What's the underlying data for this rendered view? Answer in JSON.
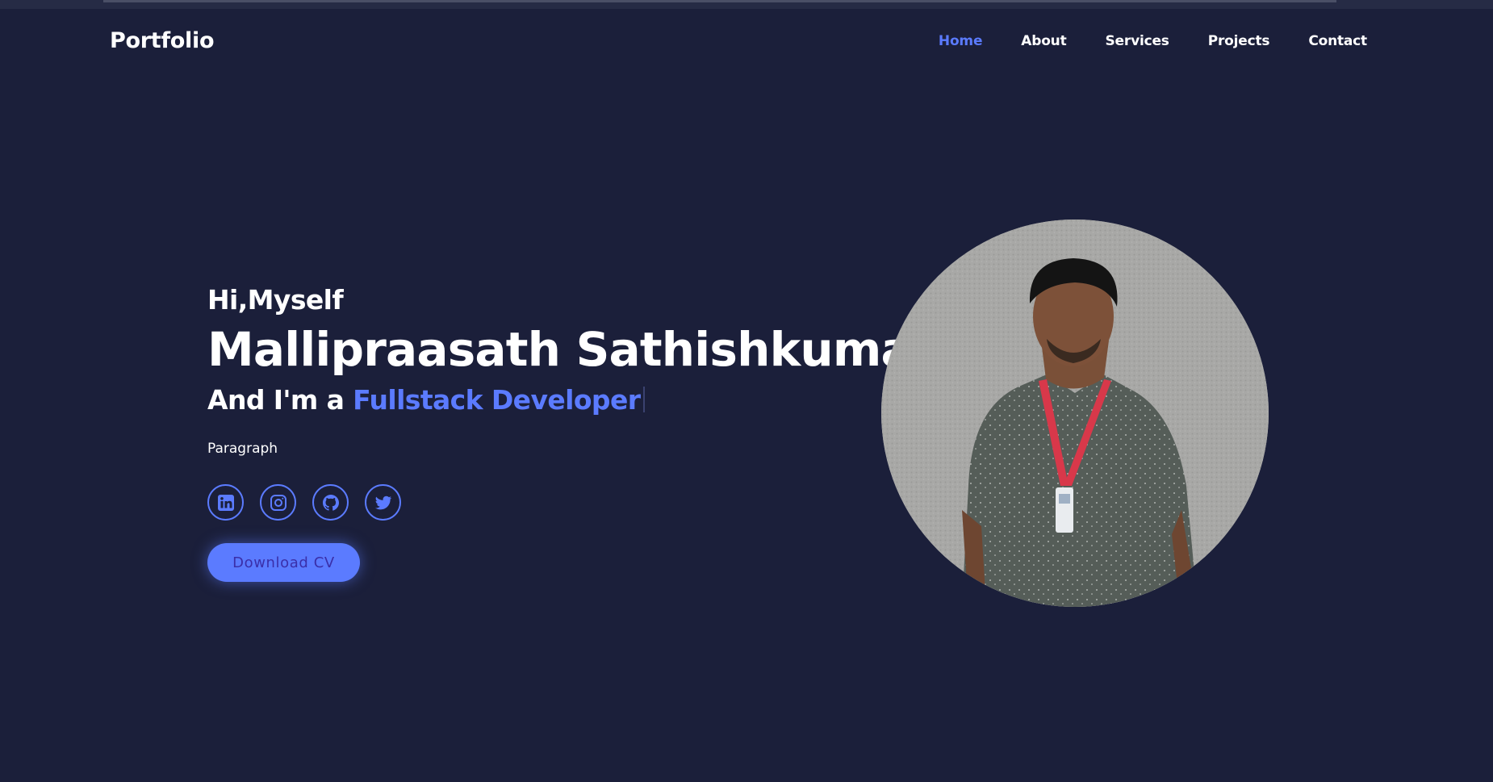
{
  "header": {
    "logo": "Portfolio",
    "nav": [
      {
        "label": "Home",
        "active": true
      },
      {
        "label": "About",
        "active": false
      },
      {
        "label": "Services",
        "active": false
      },
      {
        "label": "Projects",
        "active": false
      },
      {
        "label": "Contact",
        "active": false
      }
    ]
  },
  "hero": {
    "greeting": "Hi,Myself",
    "name": "Mallipraasath Sathishkumar",
    "role_prefix": "And I'm a",
    "role_highlight": "Fullstack Developer",
    "paragraph": "Paragraph",
    "socials": [
      {
        "icon": "linkedin-icon"
      },
      {
        "icon": "instagram-icon"
      },
      {
        "icon": "github-icon"
      },
      {
        "icon": "twitter-icon"
      }
    ],
    "cv_button": "Download CV",
    "photo_icon": "profile-photo"
  },
  "colors": {
    "background": "#1b1f3a",
    "accent": "#5b7bff",
    "text": "#ffffff",
    "button_text": "#3a2fa8"
  }
}
